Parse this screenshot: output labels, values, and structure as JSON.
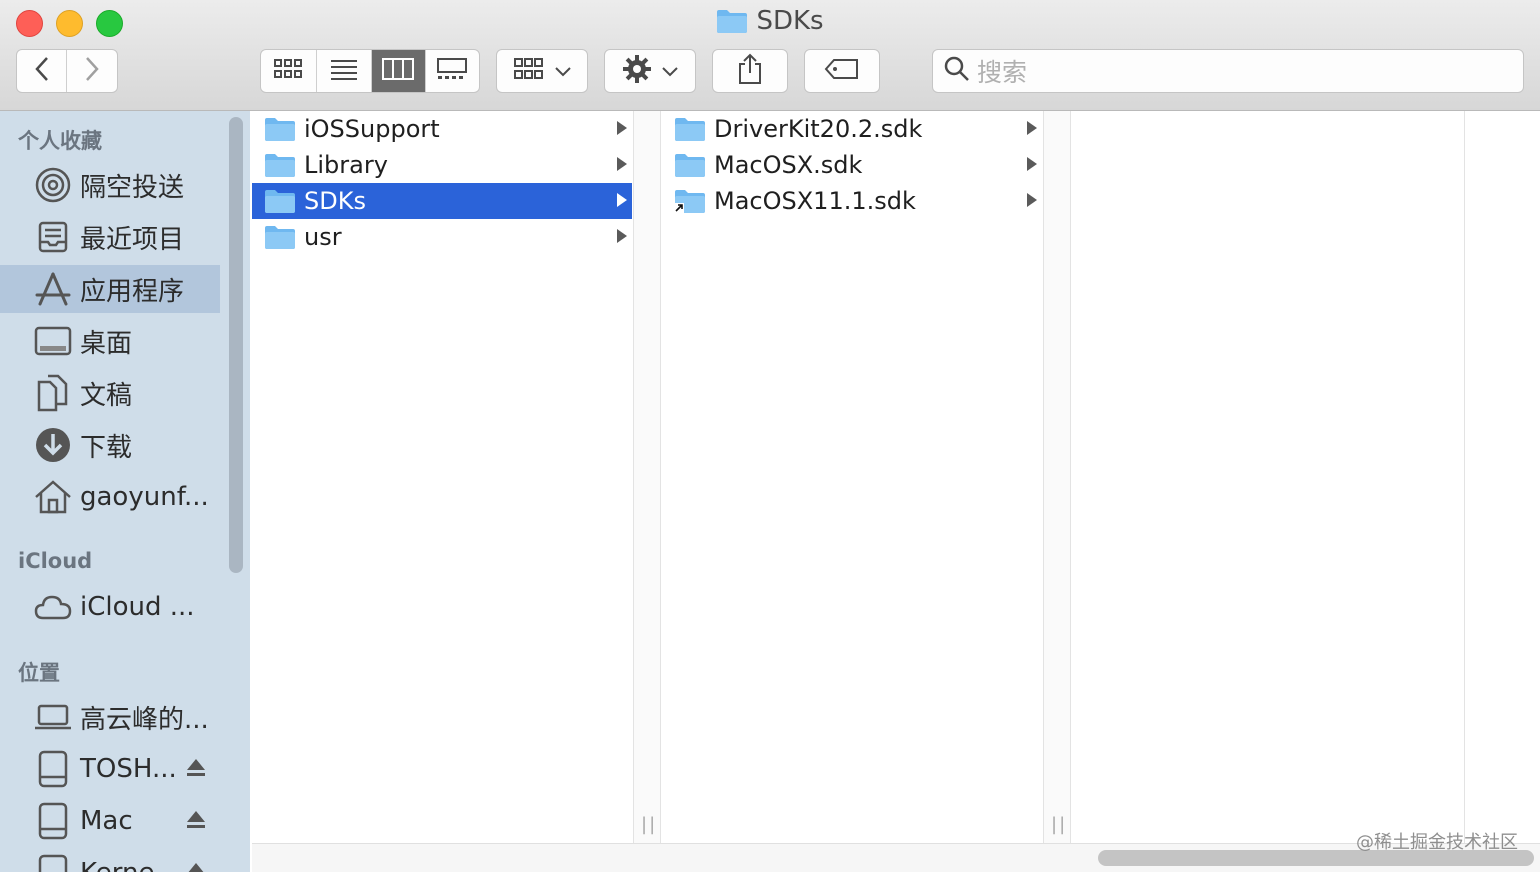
{
  "window": {
    "title": "SDKs"
  },
  "toolbar": {
    "search_placeholder": "搜索",
    "icons": [
      "chevron-left-icon",
      "chevron-right-icon",
      "icon-view-icon",
      "list-view-icon",
      "column-view-icon",
      "gallery-view-icon",
      "group-icon",
      "chevron-down-icon",
      "gear-icon",
      "share-icon",
      "tag-icon",
      "search-icon"
    ]
  },
  "sidebar": {
    "sections": [
      {
        "title": "个人收藏"
      },
      {
        "title": "iCloud"
      },
      {
        "title": "位置"
      }
    ],
    "favorites": [
      {
        "label": "隔空投送",
        "icon": "airdrop-icon"
      },
      {
        "label": "最近项目",
        "icon": "recents-icon"
      },
      {
        "label": "应用程序",
        "icon": "applications-icon"
      },
      {
        "label": "桌面",
        "icon": "desktop-icon"
      },
      {
        "label": "文稿",
        "icon": "documents-icon"
      },
      {
        "label": "下载",
        "icon": "downloads-icon"
      },
      {
        "label": "gaoyunf...",
        "icon": "home-icon"
      }
    ],
    "icloud": [
      {
        "label": "iCloud ...",
        "icon": "cloud-icon"
      }
    ],
    "locations": [
      {
        "label": "高云峰的...",
        "icon": "laptop-icon"
      },
      {
        "label": "TOSH...",
        "icon": "drive-icon"
      },
      {
        "label": "Mac",
        "icon": "drive-icon"
      },
      {
        "label": "Kerne",
        "icon": "drive-icon"
      }
    ],
    "selected": "应用程序"
  },
  "columns": {
    "col1": [
      {
        "name": "iOSSupport"
      },
      {
        "name": "Library"
      },
      {
        "name": "SDKs"
      },
      {
        "name": "usr"
      }
    ],
    "col2": [
      {
        "name": "DriverKit20.2.sdk"
      },
      {
        "name": "MacOSX.sdk"
      },
      {
        "name": "MacOSX11.1.sdk"
      }
    ],
    "selected_col1": "SDKs"
  },
  "watermark": "@稀土掘金技术社区",
  "colors": {
    "selection": "#2b63d9",
    "sidebar_bg": "#cfdde9",
    "folder": "#6fb8f0"
  }
}
